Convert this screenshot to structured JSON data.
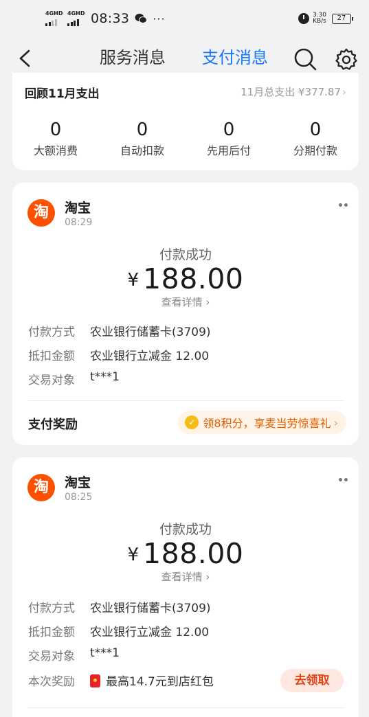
{
  "status_bar": {
    "signal1": "4GHD",
    "signal2": "4GHD",
    "time": "08:33",
    "more": "···",
    "net_speed_value": "3.30",
    "net_speed_unit": "KB/s",
    "battery": "27"
  },
  "header": {
    "tabs": [
      {
        "label": "服务消息",
        "active": false
      },
      {
        "label": "支付消息",
        "active": true
      }
    ]
  },
  "summary": {
    "title": "回顾11月支出",
    "month_total": "11月总支出 ¥377.87",
    "stats": [
      {
        "value": "0",
        "label": "大额消费"
      },
      {
        "value": "0",
        "label": "自动扣款"
      },
      {
        "value": "0",
        "label": "先用后付"
      },
      {
        "value": "0",
        "label": "分期付款"
      }
    ]
  },
  "payments": [
    {
      "logo": "淘",
      "merchant": "淘宝",
      "time": "08:29",
      "status": "付款成功",
      "currency": "¥",
      "amount": "188.00",
      "detail_link": "查看详情",
      "rows": [
        {
          "key": "付款方式",
          "value": "农业银行储蓄卡(3709)"
        },
        {
          "key": "抵扣金额",
          "value": "农业银行立减金 12.00"
        },
        {
          "key": "交易对象",
          "value": "t***1"
        }
      ],
      "reward_label": "支付奖励",
      "reward_text": "领8积分，享麦当劳惊喜礼"
    },
    {
      "logo": "淘",
      "merchant": "淘宝",
      "time": "08:25",
      "status": "付款成功",
      "currency": "¥",
      "amount": "188.00",
      "detail_link": "查看详情",
      "rows": [
        {
          "key": "付款方式",
          "value": "农业银行储蓄卡(3709)"
        },
        {
          "key": "抵扣金额",
          "value": "农业银行立减金 12.00"
        },
        {
          "key": "交易对象",
          "value": "t***1"
        }
      ],
      "reward_key": "本次奖励",
      "reward_value": "最高14.7元到店红包",
      "claim_label": "去领取"
    }
  ],
  "colors": {
    "accent": "#1677ff",
    "taobao": "#ff5000",
    "reward_orange": "#e06000",
    "red": "#e8202a"
  }
}
